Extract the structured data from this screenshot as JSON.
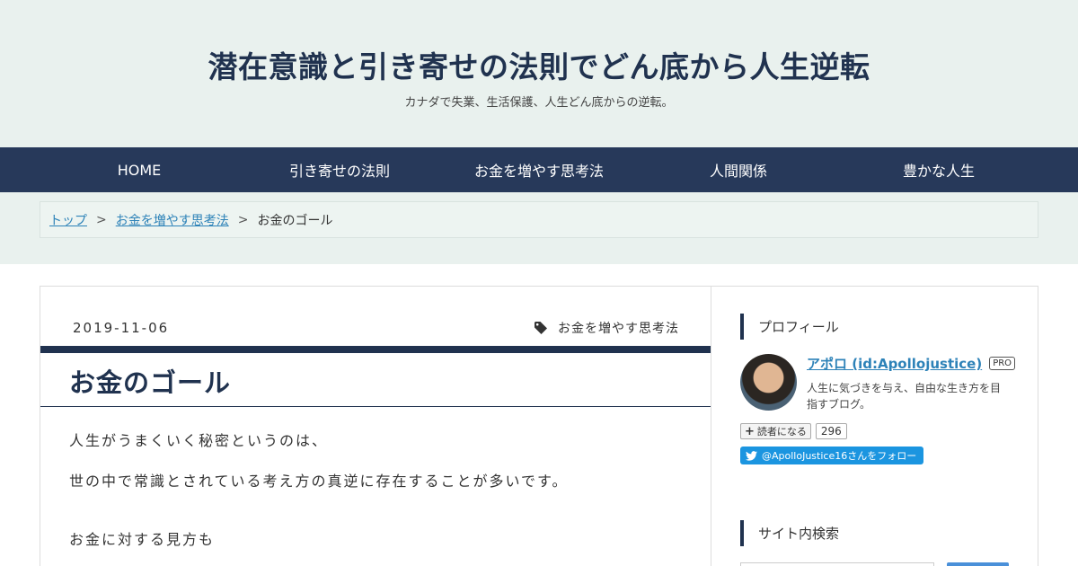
{
  "site": {
    "title": "潜在意識と引き寄せの法則でどん底から人生逆転",
    "description": "カナダで失業、生活保護、人生どん底からの逆転。"
  },
  "nav": [
    {
      "label": "HOME"
    },
    {
      "label": "引き寄せの法則"
    },
    {
      "label": "お金を増やす思考法"
    },
    {
      "label": "人間関係"
    },
    {
      "label": "豊かな人生"
    }
  ],
  "breadcrumb": {
    "top": "トップ",
    "separator": ">",
    "category": "お金を増やす思考法",
    "current": "お金のゴール"
  },
  "entry": {
    "date": "2019-11-06",
    "category": "お金を増やす思考法",
    "category_icon": "tag-icon",
    "title": "お金のゴール",
    "paragraphs": [
      "人生がうまくいく秘密というのは、",
      "世の中で常識とされている考え方の真逆に存在することが多いです。",
      "お金に対する見方も"
    ]
  },
  "sidebar": {
    "profile_heading": "プロフィール",
    "profile_name": "アポロ (id:Apollojustice)",
    "pro_badge": "PRO",
    "profile_desc": "人生に気づきを与え、自由な生き方を目指すブログ。",
    "reader_button": "読者になる",
    "reader_count": "296",
    "twitter_follow": "@ApolloJustice16さんをフォロー",
    "search_heading": "サイト内検索"
  },
  "colors": {
    "navy": "#20324f",
    "nav_bg": "#27395a",
    "header_bg": "#e9f1ee",
    "link": "#2d82b8",
    "twitter": "#1b95e0"
  }
}
